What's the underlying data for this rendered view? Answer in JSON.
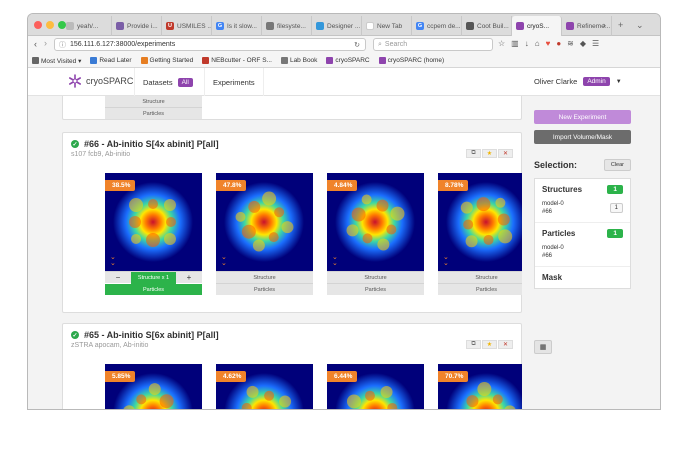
{
  "browser": {
    "tabs": [
      {
        "label": "yeah/...",
        "color": "#bbbbbb",
        "glyph": ""
      },
      {
        "label": "Provide i...",
        "color": "#7b5ea7",
        "glyph": ""
      },
      {
        "label": "USMILES ...",
        "color": "#c0392b",
        "glyph": "U"
      },
      {
        "label": "Is it slow...",
        "color": "#4285f4",
        "glyph": "G"
      },
      {
        "label": "filesyste...",
        "color": "#777777",
        "glyph": ""
      },
      {
        "label": "Designer ...",
        "color": "#3498db",
        "glyph": ""
      },
      {
        "label": "New Tab",
        "color": "#ffffff",
        "glyph": ""
      },
      {
        "label": "ccpem de...",
        "color": "#4285f4",
        "glyph": "G"
      },
      {
        "label": "Coot Buil...",
        "color": "#555555",
        "glyph": ""
      },
      {
        "label": "cryoS...",
        "color": "#8e44ad",
        "glyph": ""
      },
      {
        "label": "Refineme...",
        "color": "#8e44ad",
        "glyph": ""
      }
    ],
    "url": "156.111.6.127:38000/experiments",
    "search_placeholder": "Search",
    "bookmarks": [
      {
        "label": "Most Visited ▾",
        "color": "#666666"
      },
      {
        "label": "Read Later",
        "color": "#3a7bd5"
      },
      {
        "label": "Getting Started",
        "color": "#e67e22"
      },
      {
        "label": "NEBcutter - ORF S...",
        "color": "#c0392b"
      },
      {
        "label": "Lab Book",
        "color": "#777777"
      },
      {
        "label": "cryoSPARC",
        "color": "#8e44ad"
      },
      {
        "label": "cryoSPARC (home)",
        "color": "#8e44ad"
      }
    ]
  },
  "app": {
    "brand": "cryoSPARC",
    "nav": {
      "datasets": "Datasets",
      "datasets_badge": "All",
      "experiments": "Experiments"
    },
    "user": {
      "name": "Oliver Clarke",
      "role": "Admin"
    },
    "prev_card": {
      "row1": "Structure",
      "row2": "Particles"
    },
    "cards": [
      {
        "title": "#66 - Ab-initio S[4x abinit] P[all]",
        "subtitle": "s107 fcb9, Ab-initio",
        "tiles": [
          {
            "pct": "38.5%",
            "selected": true,
            "struct": "Structure x 1",
            "parts": "Particles",
            "minus": "−",
            "plus": "+"
          },
          {
            "pct": "47.8%",
            "selected": false,
            "struct": "Structure",
            "parts": "Particles"
          },
          {
            "pct": "4.84%",
            "selected": false,
            "struct": "Structure",
            "parts": "Particles"
          },
          {
            "pct": "8.78%",
            "selected": false,
            "struct": "Structure",
            "parts": "Particles"
          }
        ]
      },
      {
        "title": "#65 - Ab-initio S[6x abinit] P[all]",
        "subtitle": "zSTRA apocam, Ab-initio",
        "tiles": [
          {
            "pct": "5.85%"
          },
          {
            "pct": "4.62%"
          },
          {
            "pct": "6.44%"
          },
          {
            "pct": "70.7%"
          }
        ]
      }
    ],
    "sidebar": {
      "new_experiment": "New Experiment",
      "import": "Import Volume/Mask",
      "selection_title": "Selection:",
      "clear": "Clear",
      "structures": {
        "label": "Structures",
        "count": "1",
        "item_name": "model-0",
        "item_id": "#66",
        "item_count": "1"
      },
      "particles": {
        "label": "Particles",
        "count": "1",
        "item_name": "model-0",
        "item_id": "#66"
      },
      "mask": {
        "label": "Mask"
      }
    },
    "colors": {
      "accent": "#8e44ad",
      "green": "#2cb34a",
      "orange": "#f0832a",
      "new_exp": "#c08ad9",
      "import": "#6c6c6c"
    }
  }
}
